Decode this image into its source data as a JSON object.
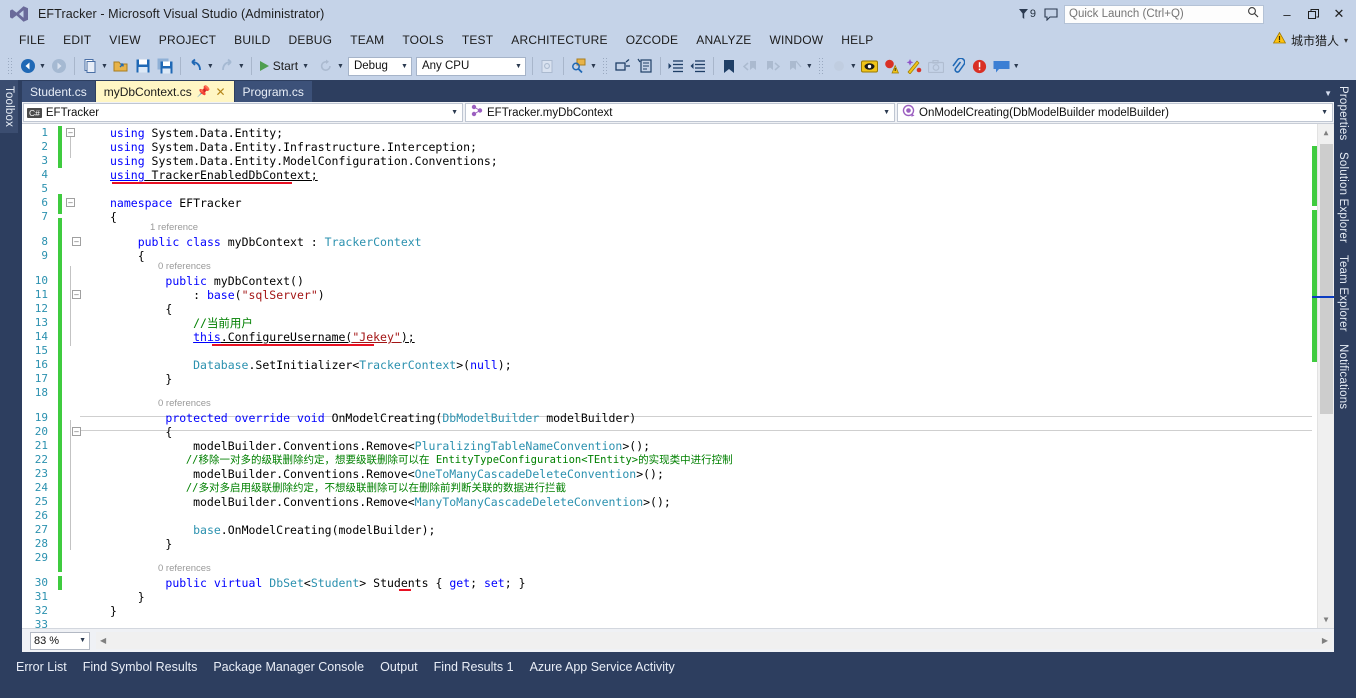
{
  "titlebar": {
    "title": "EFTracker - Microsoft Visual Studio (Administrator)",
    "logo_icon": "visual-studio-logo",
    "feedback_count": "9",
    "feedback_icon": "feedback-flag-icon",
    "speech_icon": "speech-bubble-icon",
    "quick_launch_placeholder": "Quick Launch (Ctrl+Q)",
    "quick_launch_value": "",
    "search_icon": "search-icon",
    "minimize": "–",
    "restore": "❐",
    "close": "✕"
  },
  "menubar": {
    "items": [
      "FILE",
      "EDIT",
      "VIEW",
      "PROJECT",
      "BUILD",
      "DEBUG",
      "TEAM",
      "TOOLS",
      "TEST",
      "ARCHITECTURE",
      "OZCODE",
      "ANALYZE",
      "WINDOW",
      "HELP"
    ],
    "warning_icon": "warning-triangle-icon",
    "user": "城市猎人",
    "user_caret": "▾"
  },
  "toolbar": {
    "nav_back_icon": "navigate-back-icon",
    "nav_fwd_icon": "navigate-forward-icon",
    "new_item_icon": "new-item-icon",
    "open_file_icon": "open-file-icon",
    "save_icon": "save-icon",
    "save_all_icon": "save-all-icon",
    "undo_icon": "undo-icon",
    "redo_icon": "redo-icon",
    "start_icon": "start-play-icon",
    "start_label": "Start",
    "restart_icon": "restart-icon",
    "config_value": "Debug",
    "platform_value": "Any CPU",
    "find_icon": "find-in-files-icon",
    "comment_icon": "comment-selection-icon",
    "uncomment_icon": "uncomment-selection-icon",
    "indent_icon": "increase-indent-icon",
    "outdent_icon": "decrease-indent-icon",
    "bookmark_icon": "bookmark-icon",
    "prev_bookmark_icon": "previous-bookmark-icon",
    "next_bookmark_icon": "next-bookmark-icon",
    "clear_bookmark_icon": "clear-bookmarks-icon",
    "ozcode_search_icon": "ozcode-search-icon",
    "ozcode_eye_icon": "ozcode-reveal-icon",
    "ozcode_alert_icon": "ozcode-exception-icon",
    "ozcode_magic_icon": "ozcode-magic-wand-icon",
    "camera_icon": "screenshot-camera-icon",
    "link_icon": "attach-link-icon",
    "error_icon": "error-circle-icon",
    "chat_icon": "comment-bubble-icon",
    "overflow_icon": "toolbar-overflow-icon"
  },
  "dock_left": {
    "tabs": [
      "Toolbox"
    ]
  },
  "dock_right": {
    "tabs": [
      "Properties",
      "Solution Explorer",
      "Team Explorer",
      "Notifications"
    ]
  },
  "document_tabs": [
    {
      "label": "Student.cs",
      "active": false
    },
    {
      "label": "myDbContext.cs",
      "active": true,
      "pin_icon": "pin-icon",
      "close_icon": "close-icon"
    },
    {
      "label": "Program.cs",
      "active": false
    }
  ],
  "tab_overflow_icon": "tab-overflow-chevron-icon",
  "navbar": {
    "project": {
      "icon": "csharp-project-icon",
      "icon_label": "C#",
      "value": "EFTracker",
      "caret": "▾"
    },
    "type": {
      "icon": "class-icon",
      "value": "EFTracker.myDbContext",
      "caret": "▾"
    },
    "member": {
      "icon": "method-icon",
      "value": "OnModelCreating(DbModelBuilder modelBuilder)",
      "caret": "▾"
    }
  },
  "editor": {
    "zoom_value": "83 %",
    "zoom_caret": "▾",
    "split_icon": "split-view-icon",
    "scroll_up_icon": "scroll-up-arrow-icon",
    "scroll_down_icon": "scroll-down-arrow-icon",
    "hscroll_left_icon": "scroll-left-arrow-icon",
    "hscroll_right_icon": "scroll-right-arrow-icon",
    "codelens": {
      "class_myDbContext": "1 reference",
      "ctor_myDbContext": "0 references",
      "onmodelcreating": "0 references",
      "students": "0 references"
    },
    "lines": [
      {
        "n": 1,
        "text": "using System.Data.Entity;"
      },
      {
        "n": 2,
        "text": "using System.Data.Entity.Infrastructure.Interception;"
      },
      {
        "n": 3,
        "text": "using System.Data.Entity.ModelConfiguration.Conventions;"
      },
      {
        "n": 4,
        "text": "using TrackerEnabledDbContext;"
      },
      {
        "n": 5,
        "text": ""
      },
      {
        "n": 6,
        "text": "namespace EFTracker"
      },
      {
        "n": 7,
        "text": "{"
      },
      {
        "n": 8,
        "text": "    public class myDbContext : TrackerContext"
      },
      {
        "n": 9,
        "text": "    {"
      },
      {
        "n": 10,
        "text": "        public myDbContext()"
      },
      {
        "n": 11,
        "text": "            : base(\"sqlServer\")"
      },
      {
        "n": 12,
        "text": "        {"
      },
      {
        "n": 13,
        "text": "            //当前用户"
      },
      {
        "n": 14,
        "text": "            this.ConfigureUsername(\"Jekey\");"
      },
      {
        "n": 15,
        "text": ""
      },
      {
        "n": 16,
        "text": "            Database.SetInitializer<TrackerContext>(null);"
      },
      {
        "n": 17,
        "text": "        }"
      },
      {
        "n": 18,
        "text": ""
      },
      {
        "n": 19,
        "text": "        protected override void OnModelCreating(DbModelBuilder modelBuilder)"
      },
      {
        "n": 20,
        "text": "        {"
      },
      {
        "n": 21,
        "text": "            modelBuilder.Conventions.Remove<PluralizingTableNameConvention>();"
      },
      {
        "n": 22,
        "text": "            //移除一对多的级联删除约定，想要级联删除可以在 EntityTypeConfiguration<TEntity>的实现类中进行控制"
      },
      {
        "n": 23,
        "text": "            modelBuilder.Conventions.Remove<OneToManyCascadeDeleteConvention>();"
      },
      {
        "n": 24,
        "text": "            //多对多启用级联删除约定，不想级联删除可以在删除前判断关联的数据进行拦截"
      },
      {
        "n": 25,
        "text": "            modelBuilder.Conventions.Remove<ManyToManyCascadeDeleteConvention>();"
      },
      {
        "n": 26,
        "text": ""
      },
      {
        "n": 27,
        "text": "            base.OnModelCreating(modelBuilder);"
      },
      {
        "n": 28,
        "text": "        }"
      },
      {
        "n": 29,
        "text": ""
      },
      {
        "n": 30,
        "text": "        public virtual DbSet<Student> Students { get; set; }"
      },
      {
        "n": 31,
        "text": "    }"
      },
      {
        "n": 32,
        "text": "}"
      },
      {
        "n": 33,
        "text": ""
      }
    ]
  },
  "bottom_tabs": [
    "Error List",
    "Find Symbol Results",
    "Package Manager Console",
    "Output",
    "Find Results 1",
    "Azure App Service Activity"
  ],
  "colors": {
    "chrome": "#c5d3e8",
    "shell_dark": "#2d3e5f",
    "active_tab": "#fff6c4",
    "keyword": "#0000ff",
    "type": "#2b91af",
    "string": "#a31515",
    "comment": "#008000",
    "error_underline": "#e81123",
    "changebar_saved": "#3fcb3f"
  }
}
